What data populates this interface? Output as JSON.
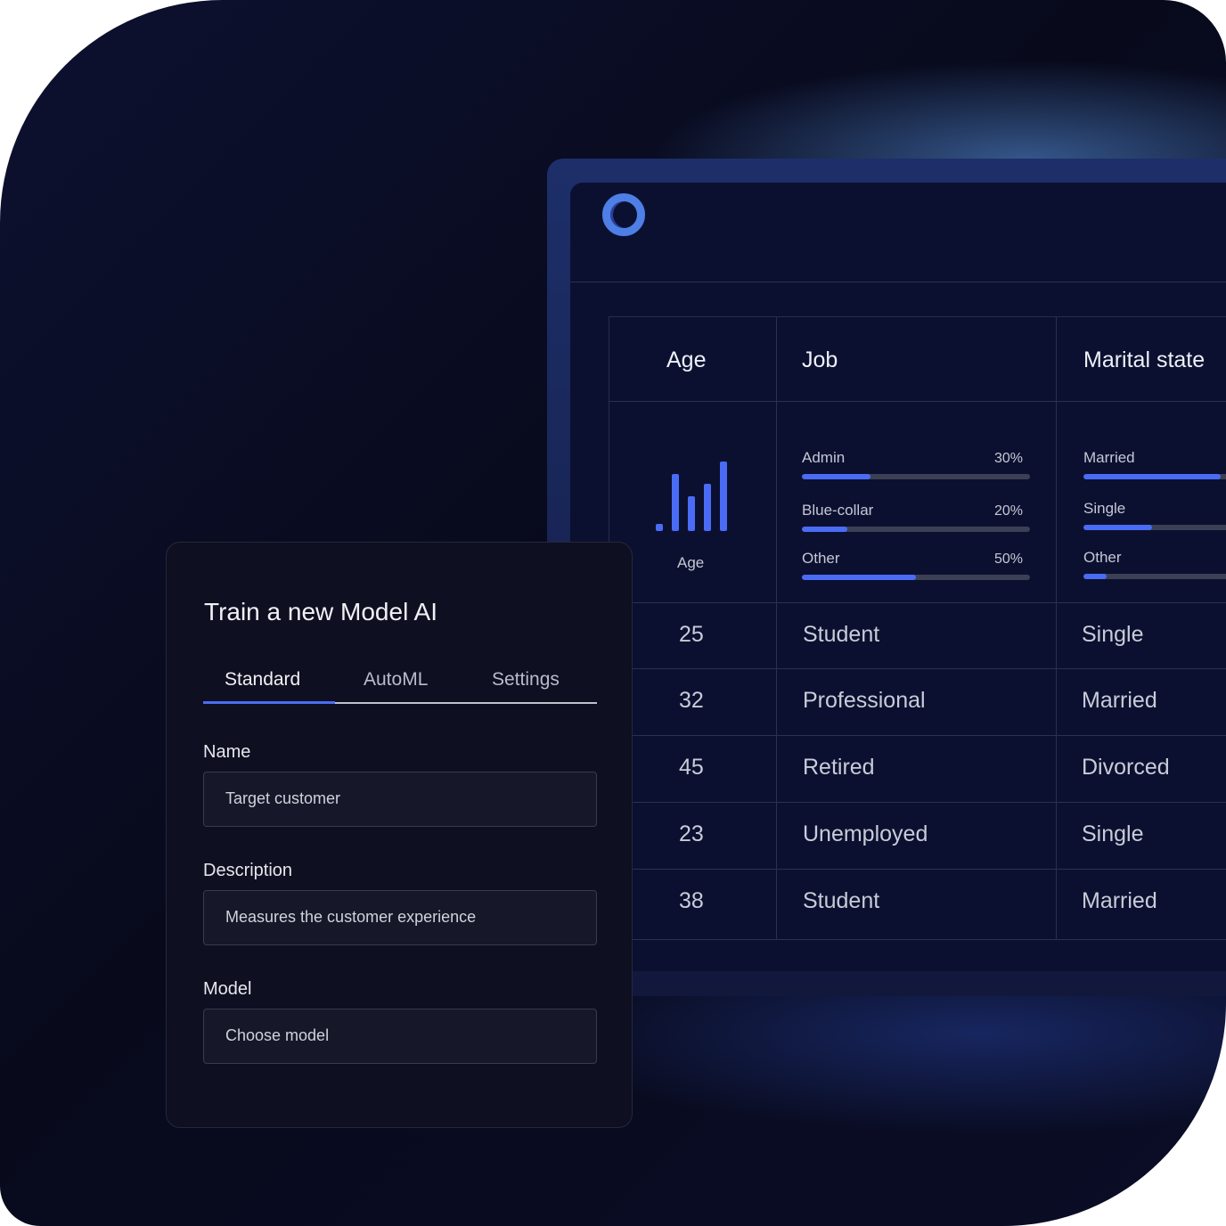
{
  "table": {
    "headers": [
      "Age",
      "Job",
      "Marital state"
    ],
    "age_summary_label": "Age",
    "age_histogram": [
      0.1,
      0.82,
      0.5,
      0.68,
      1.0
    ],
    "job_dist": [
      {
        "label": "Admin",
        "pct": "30%",
        "value": 30
      },
      {
        "label": "Blue-collar",
        "pct": "20%",
        "value": 20
      },
      {
        "label": "Other",
        "pct": "50%",
        "value": 50
      }
    ],
    "marital_dist": [
      {
        "label": "Married",
        "value": 60
      },
      {
        "label": "Single",
        "value": 30
      },
      {
        "label": "Other",
        "value": 10
      }
    ],
    "rows": [
      [
        "25",
        "Student",
        "Single"
      ],
      [
        "32",
        "Professional",
        "Married"
      ],
      [
        "45",
        "Retired",
        "Divorced"
      ],
      [
        "23",
        "Unemployed",
        "Single"
      ],
      [
        "38",
        "Student",
        "Married"
      ]
    ]
  },
  "card": {
    "title": "Train a new Model AI",
    "tabs": [
      "Standard",
      "AutoML",
      "Settings"
    ],
    "active_tab": "Standard",
    "fields": [
      {
        "label": "Name",
        "value": "Target customer"
      },
      {
        "label": "Description",
        "value": "Measures the customer experience"
      },
      {
        "label": "Model",
        "value": "Choose model"
      }
    ]
  },
  "colors": {
    "accent": "#4a6cf5",
    "background": "#0a0c22"
  }
}
